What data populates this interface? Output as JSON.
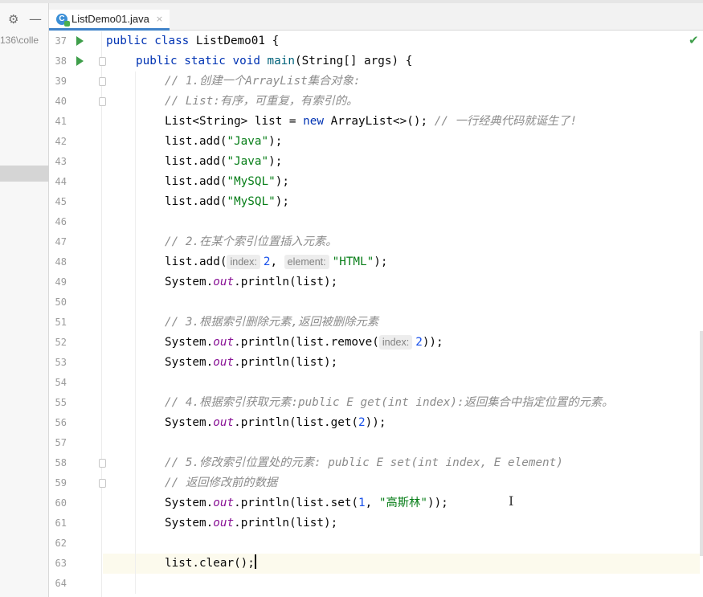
{
  "left_panel": {
    "settings_icon": "gear-icon",
    "minimize_icon": "minus-icon",
    "path_fragment": "136\\colle"
  },
  "tabs": [
    {
      "title": "ListDemo01.java",
      "icon": "java-class-icon",
      "close": "×"
    }
  ],
  "gutter": {
    "line_numbers": [
      "37",
      "38",
      "39",
      "40",
      "41",
      "42",
      "43",
      "44",
      "45",
      "46",
      "47",
      "48",
      "49",
      "50",
      "51",
      "52",
      "53",
      "54",
      "55",
      "56",
      "57",
      "58",
      "59",
      "60",
      "61",
      "62",
      "63",
      "64"
    ]
  },
  "code_lines": [
    {
      "kw1": "public class ",
      "name": "ListDemo01 {"
    },
    {
      "kw1": "public static void ",
      "fn": "main",
      "rest": "(String[] args) {"
    },
    {
      "cm": "// 1.创建一个ArrayList集合对象:"
    },
    {
      "cm": "// List:有序，可重复，有索引的。"
    },
    {
      "a": "List<String> list = ",
      "kw": "new",
      "b": " ArrayList<>(); ",
      "cm": "// 一行经典代码就诞生了!"
    },
    {
      "a": "list.add(",
      "str": "\"Java\"",
      "b": ");"
    },
    {
      "a": "list.add(",
      "str": "\"Java\"",
      "b": ");"
    },
    {
      "a": "list.add(",
      "str": "\"MySQL\"",
      "b": ");"
    },
    {
      "a": "list.add(",
      "str": "\"MySQL\"",
      "b": ");"
    },
    {
      "cm": "// 2.在某个索引位置插入元素。"
    },
    {
      "a": "list.add(",
      "hint1": "index:",
      "num": "2",
      "sep": ", ",
      "hint2": "element:",
      "str": "\"HTML\"",
      "b": ");"
    },
    {
      "a": "System.",
      "st": "out",
      "b": ".println(list);"
    },
    {
      "cm": "// 3.根据索引删除元素,返回被删除元素"
    },
    {
      "a": "System.",
      "st": "out",
      "b": ".println(list.remove(",
      "hint1": "index:",
      "num": "2",
      "c": "));"
    },
    {
      "a": "System.",
      "st": "out",
      "b": ".println(list);"
    },
    {
      "cm": "// 4.根据索引获取元素:public E get(int index):返回集合中指定位置的元素。"
    },
    {
      "a": "System.",
      "st": "out",
      "b": ".println(list.get(",
      "num": "2",
      "c": "));"
    },
    {
      "cm": "// 5.修改索引位置处的元素: public E set(int index, E element)"
    },
    {
      "cm": "// 返回修改前的数据"
    },
    {
      "a": "System.",
      "st": "out",
      "b": ".println(list.set(",
      "num": "1",
      "sep": ", ",
      "str": "\"高斯林\"",
      "c": "));"
    },
    {
      "a": "System.",
      "st": "out",
      "b": ".println(list);"
    },
    {
      "a": "list.clear();"
    }
  ],
  "status": {
    "inspection_icon": "checkmark-icon",
    "mouse_cursor": "I"
  }
}
